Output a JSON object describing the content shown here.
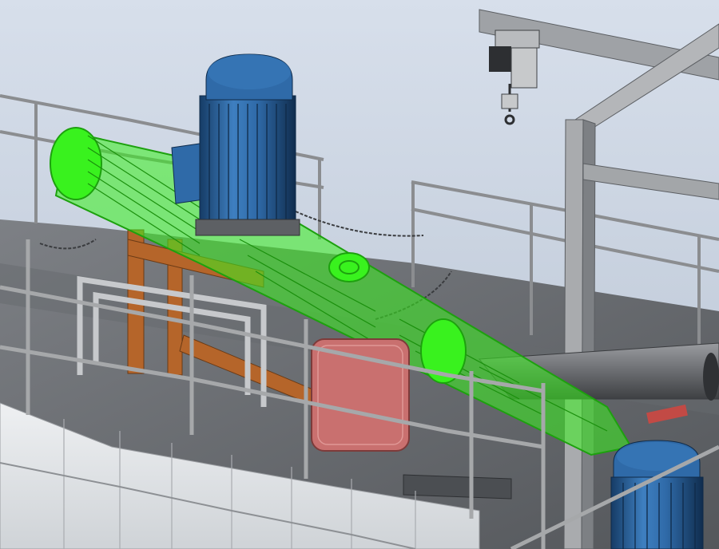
{
  "scene": {
    "type": "cad-3d-viewport",
    "colors": {
      "background_top": "#d7dfeb",
      "background_bottom": "#b9c4d3",
      "selected_highlight": "#39f21e",
      "selected_highlight_dark": "#1da10e",
      "motor_blue": "#2f6aa8",
      "motor_blue_dark": "#163c66",
      "steel_grey": "#8c8f93",
      "deck_grey": "#6e7175",
      "hull_white": "#e8eaec",
      "frame_orange": "#b5652a",
      "tank_pink": "#c9706f",
      "rail_grey": "#a6a8aa"
    },
    "components": [
      {
        "name": "vertical-drive-motor",
        "color": "motor_blue",
        "selected": false
      },
      {
        "name": "horizontal-pump-assembly",
        "color": "selected_highlight",
        "selected": true
      },
      {
        "name": "lower-drive-motor",
        "color": "motor_blue",
        "selected": false
      },
      {
        "name": "overhead-hoist-trolley",
        "color": "steel_grey",
        "selected": false
      },
      {
        "name": "gantry-frame",
        "color": "rail_grey",
        "selected": false
      },
      {
        "name": "pump-support-frame",
        "color": "frame_orange",
        "selected": false
      },
      {
        "name": "guard-tank",
        "color": "tank_pink",
        "selected": false
      },
      {
        "name": "deck-platform",
        "color": "deck_grey",
        "selected": false
      },
      {
        "name": "safety-railing",
        "color": "rail_grey",
        "selected": false
      },
      {
        "name": "hull-wall",
        "color": "hull_white",
        "selected": false
      }
    ]
  }
}
